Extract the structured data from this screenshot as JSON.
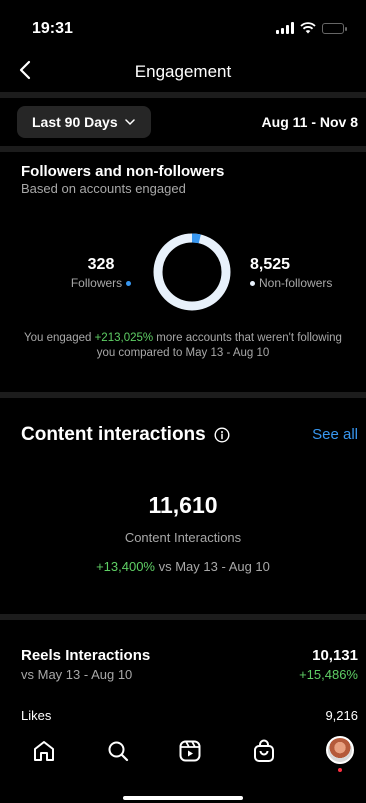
{
  "status_bar": {
    "time": "19:31"
  },
  "nav": {
    "title": "Engagement"
  },
  "filter": {
    "range_label": "Last 90 Days",
    "date_span": "Aug 11 - Nov 8"
  },
  "followers_section": {
    "title": "Followers and non-followers",
    "subtitle": "Based on accounts engaged",
    "followers_value": "328",
    "followers_label": "Followers",
    "non_followers_value": "8,525",
    "non_followers_label": "Non-followers",
    "followers_share": 0.037,
    "note_prefix": "You engaged ",
    "note_highlight": "+213,025%",
    "note_suffix": " more accounts that weren't following you compared to May 13 - Aug 10",
    "colors": {
      "followers": "#3897f0",
      "non_followers": "#e8f1fb"
    }
  },
  "content_interactions": {
    "title": "Content interactions",
    "see_all": "See all",
    "value": "11,610",
    "label": "Content Interactions",
    "change": "+13,400%",
    "compare": " vs May 13 - Aug 10"
  },
  "reels": {
    "title": "Reels Interactions",
    "subtitle": "vs May 13 - Aug 10",
    "value": "10,131",
    "change": "+15,486%",
    "likes_label": "Likes",
    "likes_value": "9,216"
  },
  "tabbar": {
    "icons": [
      "home-icon",
      "search-icon",
      "reels-icon",
      "shop-icon",
      "profile-avatar"
    ]
  }
}
